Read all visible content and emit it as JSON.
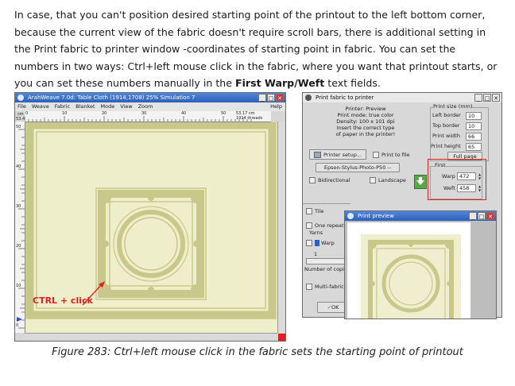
{
  "paragraph": {
    "text": "In case, that you can't position desired starting point of the printout to the left bottom corner, because the current view of the fabric doesn't require scroll bars, there is additional setting in the Print fabric to printer window -coordinates of starting point in fabric. You can set the numbers in two ways: Ctrl+left mouse click in the fabric, where you want that printout starts, or you can set these numbers manually in the ",
    "bold": "First Warp/Weft",
    "tail": " text fields."
  },
  "caption": "Figure 283: Ctrl+left mouse click in the fabric sets the starting point of printout",
  "main_window": {
    "title": "ArahWeave 7.0d: Table Cloth (1914,1708) 25% Simulation 7",
    "menu": [
      "File",
      "Weave",
      "Fabric",
      "Blanket",
      "Mode",
      "View",
      "Zoom"
    ],
    "help": "Help",
    "ruler_top_labels": [
      "0",
      "10",
      "20",
      "30",
      "40",
      "50"
    ],
    "ruler_info_1": "53.17 cm",
    "ruler_info_2": "1914 threads",
    "ruler_unit": "cm",
    "ruler_corner": "53.4",
    "ruler_left_labels": [
      "50",
      "40",
      "30",
      "20",
      "10",
      "0"
    ],
    "annotation": "CTRL + click"
  },
  "print_dialog": {
    "title": "Print fabric to printer",
    "info_lines": [
      "Printer: Preview",
      "Print mode: true color",
      "Density: 100 x 101 dpi",
      "Insert the correct type",
      "of paper in the printer!"
    ],
    "print_size_label": "Print size (mm)",
    "left_border_label": "Left border",
    "left_border_value": "10",
    "top_border_label": "Top border",
    "top_border_value": "10",
    "print_width_label": "Print width",
    "print_width_value": "66",
    "print_height_label": "Print height",
    "print_height_value": "65",
    "full_page_label": "Full page",
    "printer_setup_label": "Printer setup...",
    "print_to_file_label": "Print to file",
    "printer_model": "Epson-Stylus-Photo-P50 --",
    "bidirectional_label": "Bidirectional",
    "landscape_label": "Landscape",
    "first_label": "First",
    "warp_label": "Warp",
    "warp_value": "472",
    "weft_label": "Weft",
    "weft_value": "458",
    "tile_label": "Tile",
    "one_repeat_label": "One repeat",
    "yarns_label": "Yarns",
    "warp_chk_label": "Warp",
    "counter_value": "1",
    "copies_label": "Number of copie",
    "multi_fabric_label": "Multi-fabric",
    "ok_label": "OK"
  },
  "preview_window": {
    "title": "Print preview"
  },
  "colors": {
    "title_blue": "#2f68c6",
    "fabric_bg": "#eeeecb",
    "ornament": "#c8c88a",
    "highlight_red": "#e02020"
  }
}
